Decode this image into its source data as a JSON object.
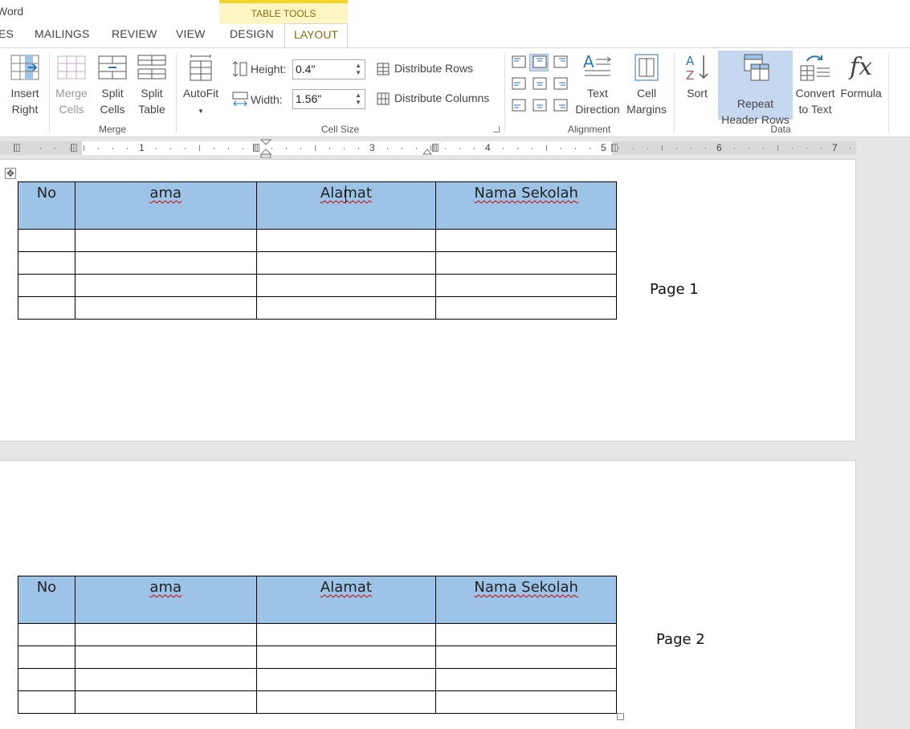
{
  "app": {
    "title": "Word"
  },
  "context_tab": {
    "label": "TABLE TOOLS"
  },
  "tabs": [
    {
      "label": "ES"
    },
    {
      "label": "MAILINGS"
    },
    {
      "label": "REVIEW"
    },
    {
      "label": "VIEW"
    },
    {
      "label": "DESIGN"
    },
    {
      "label": "LAYOUT",
      "active": true
    }
  ],
  "ribbon": {
    "insert_right": {
      "line1": "Insert",
      "line2": "Right"
    },
    "merge_group": {
      "label": "Merge",
      "merge_cells": {
        "line1": "Merge",
        "line2": "Cells",
        "enabled": false
      },
      "split_cells": {
        "line1": "Split",
        "line2": "Cells"
      },
      "split_table": {
        "line1": "Split",
        "line2": "Table"
      }
    },
    "cell_size_group": {
      "label": "Cell Size",
      "autofit": {
        "label": "AutoFit"
      },
      "height": {
        "label": "Height:",
        "value": "0.4\""
      },
      "width": {
        "label": "Width:",
        "value": "1.56\""
      },
      "distribute_rows": "Distribute Rows",
      "distribute_columns": "Distribute Columns"
    },
    "alignment_group": {
      "label": "Alignment",
      "text_direction": {
        "line1": "Text",
        "line2": "Direction"
      },
      "cell_margins": {
        "line1": "Cell",
        "line2": "Margins"
      }
    },
    "data_group": {
      "label": "Data",
      "sort": {
        "line1": "Sort"
      },
      "repeat_header_rows": {
        "line1": "Repeat",
        "line2": "Header Rows",
        "active": true
      },
      "convert_to_text": {
        "line1": "Convert",
        "line2": "to Text"
      },
      "formula": {
        "line1": "Formula"
      }
    }
  },
  "ruler": {
    "numbers": [
      "1",
      "3",
      "4",
      "5",
      "6",
      "7"
    ]
  },
  "document": {
    "table_headers": [
      "No",
      "ama",
      "Alamat",
      "Nama Sekolah"
    ],
    "body_rows": 4,
    "page1_label": "Page 1",
    "page2_label": "Page 2"
  },
  "colors": {
    "header_fill": "#9dc3e6",
    "context_tab_accent": "#f4d32c",
    "active_button": "#c5d8ef"
  }
}
